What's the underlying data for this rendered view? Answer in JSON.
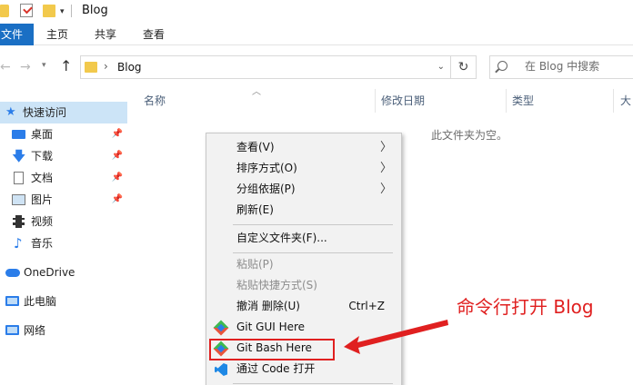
{
  "window": {
    "title": "Blog"
  },
  "ribbon": {
    "tabs": [
      "文件",
      "主页",
      "共享",
      "查看"
    ]
  },
  "address": {
    "path": "Blog"
  },
  "search": {
    "placeholder": "在 Blog 中搜索"
  },
  "sidebar": {
    "quick_access": "快速访问",
    "items": [
      {
        "label": "桌面",
        "icon": "desktop-icon",
        "pinned": true
      },
      {
        "label": "下载",
        "icon": "download-icon",
        "pinned": true
      },
      {
        "label": "文档",
        "icon": "document-icon",
        "pinned": true
      },
      {
        "label": "图片",
        "icon": "picture-icon",
        "pinned": true
      },
      {
        "label": "视频",
        "icon": "video-icon",
        "pinned": false
      },
      {
        "label": "音乐",
        "icon": "music-icon",
        "pinned": false
      }
    ],
    "onedrive": "OneDrive",
    "this_pc": "此电脑",
    "network": "网络"
  },
  "columns": [
    "名称",
    "修改日期",
    "类型",
    "大"
  ],
  "empty_message": "此文件夹为空。",
  "context_menu": {
    "items": [
      {
        "label": "查看(V)",
        "submenu": true,
        "disabled": false
      },
      {
        "label": "排序方式(O)",
        "submenu": true,
        "disabled": false
      },
      {
        "label": "分组依据(P)",
        "submenu": true,
        "disabled": false
      },
      {
        "label": "刷新(E)",
        "submenu": false,
        "disabled": false
      },
      {
        "label": "自定义文件夹(F)...",
        "submenu": false,
        "disabled": false
      },
      {
        "label": "粘贴(P)",
        "submenu": false,
        "disabled": true
      },
      {
        "label": "粘贴快捷方式(S)",
        "submenu": false,
        "disabled": true
      },
      {
        "label": "撤消 删除(U)",
        "shortcut": "Ctrl+Z",
        "disabled": false
      },
      {
        "label": "Git GUI Here",
        "icon": "git-icon",
        "disabled": false
      },
      {
        "label": "Git Bash Here",
        "icon": "git-icon",
        "disabled": false,
        "highlighted": true
      },
      {
        "label": "通过 Code 打开",
        "icon": "vscode-icon",
        "disabled": false
      }
    ]
  },
  "annotation": {
    "text": "命令行打开 Blog",
    "color": "#e02020"
  },
  "colors": {
    "accent": "#1a6fc4",
    "selection": "#cce4f7",
    "annotation": "#e02020"
  }
}
